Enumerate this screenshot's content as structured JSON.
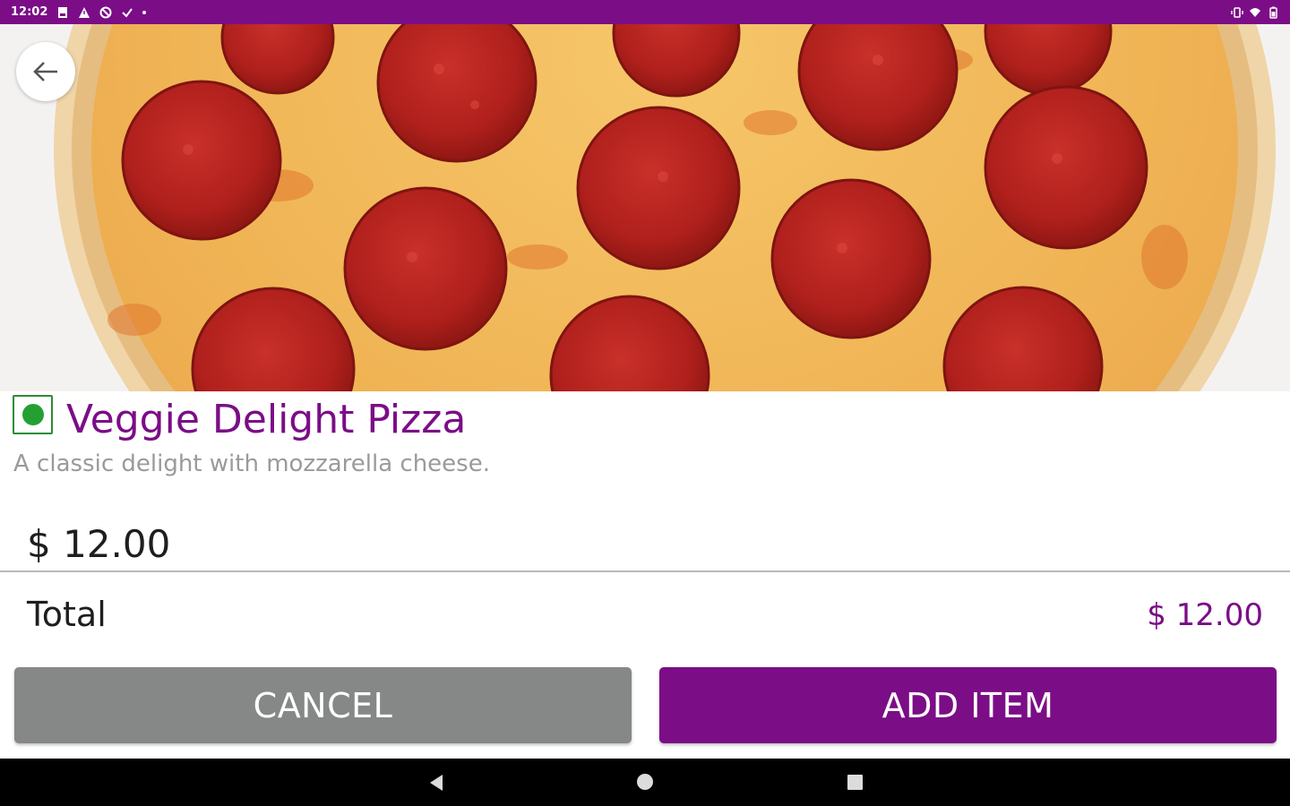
{
  "status_bar": {
    "time": "12:02",
    "left_icons": [
      "sim-card-icon",
      "warning-icon",
      "do-not-disturb-icon",
      "check-icon",
      "dot-icon"
    ],
    "right_icons": [
      "vibrate-icon",
      "wifi-icon",
      "battery-icon"
    ],
    "background": "#7b0d87"
  },
  "hero": {
    "image": "pepperoni-pizza-image",
    "back_icon": "arrow-left-icon"
  },
  "item": {
    "veg_icon": "veg-indicator-icon",
    "title": "Veggie Delight Pizza",
    "description": "A classic delight with mozzarella cheese.",
    "price": "$ 12.00"
  },
  "summary": {
    "total_label": "Total",
    "total_value": "$ 12.00"
  },
  "actions": {
    "cancel_label": "CANCEL",
    "add_label": "ADD ITEM"
  },
  "colors": {
    "brand": "#7b0d87",
    "cancel": "#858886",
    "veg_green": "#24a033"
  },
  "nav_bar": {
    "icons": [
      "nav-back-icon",
      "nav-home-icon",
      "nav-recents-icon"
    ]
  }
}
